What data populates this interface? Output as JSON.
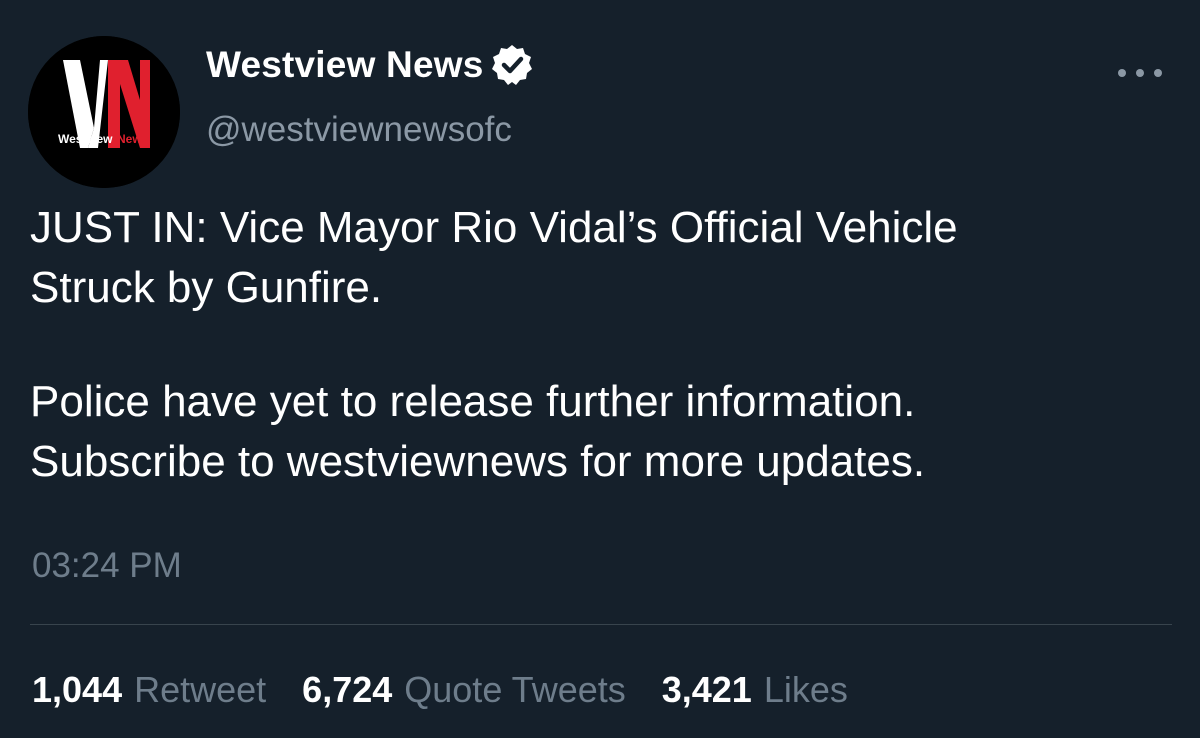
{
  "account": {
    "display_name": "Westview News",
    "handle": "@westviewnewsofc",
    "verified": true,
    "avatar": {
      "logo_letters": "VN",
      "caption_part1": "Westview",
      "caption_part2": "News",
      "colors": {
        "background": "#000000",
        "letter_v": "#ffffff",
        "letter_n": "#e0202e"
      }
    }
  },
  "tweet": {
    "line1": "JUST IN: Vice Mayor Rio Vidal’s Official Vehicle",
    "line2": "Struck by Gunfire.",
    "line3": "Police have yet to release further information.",
    "line4": "Subscribe to westviewnews for more updates.",
    "time": "03:24 PM"
  },
  "stats": {
    "retweets": {
      "count": "1,044",
      "label": "Retweet"
    },
    "quotes": {
      "count": "6,724",
      "label": "Quote Tweets"
    },
    "likes": {
      "count": "3,421",
      "label": "Likes"
    }
  },
  "colors": {
    "background": "#15202b",
    "text": "#ffffff",
    "secondary": "#8b98a5",
    "divider": "#38444d"
  },
  "icons": {
    "verified": "verified-badge-icon",
    "more": "more-options-icon"
  }
}
